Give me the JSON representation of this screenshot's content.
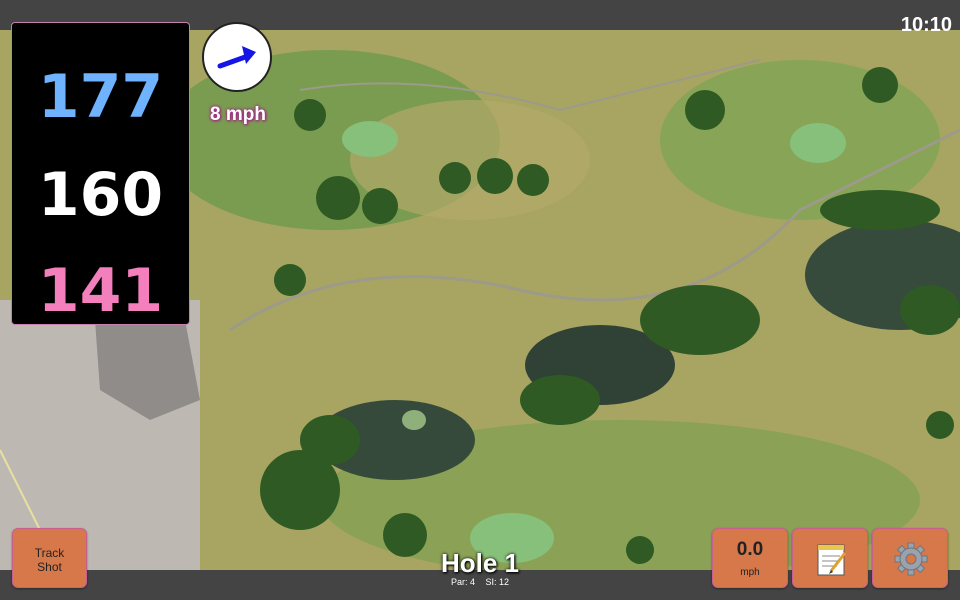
{
  "status": {
    "time": "10:10"
  },
  "distances": {
    "back": "177",
    "middle": "160",
    "front": "141"
  },
  "wind": {
    "speed_label": "8 mph",
    "direction_icon": "wind-arrow-icon"
  },
  "hole": {
    "title": "Hole 1",
    "par": "Par: 4",
    "si": "SI: 12"
  },
  "buttons": {
    "track_line1": "Track",
    "track_line2": "Shot",
    "wind_value": "0.0",
    "wind_unit": "mph",
    "notes_icon": "notepad-icon",
    "settings_icon": "gear-icon"
  },
  "colors": {
    "back": "#6fb2ff",
    "middle": "#ffffff",
    "front": "#f47fbd",
    "button": "#d7784a",
    "accent": "#c8608f"
  }
}
